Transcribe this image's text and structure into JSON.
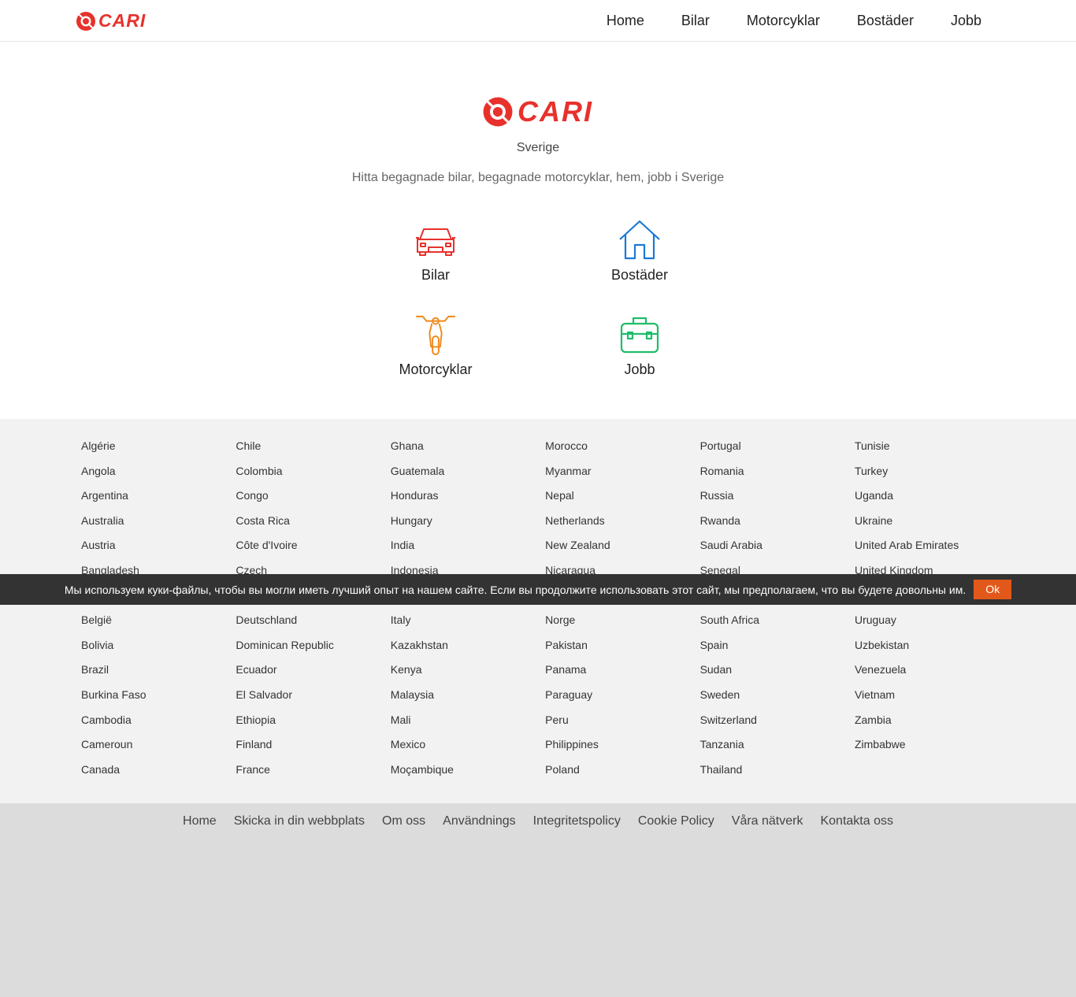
{
  "brand": {
    "name": "CARI",
    "accent": "#e8312c"
  },
  "nav": [
    "Home",
    "Bilar",
    "Motorcyklar",
    "Bostäder",
    "Jobb"
  ],
  "hero": {
    "country": "Sverige",
    "tagline": "Hitta begagnade bilar, begagnade motorcyklar, hem, jobb i Sverige",
    "categories": [
      {
        "label": "Bilar",
        "icon": "car-icon",
        "color": "#e8312c"
      },
      {
        "label": "Bostäder",
        "icon": "house-icon",
        "color": "#1a7ad4"
      },
      {
        "label": "Motorcyklar",
        "icon": "motorcycle-icon",
        "color": "#f0881a"
      },
      {
        "label": "Jobb",
        "icon": "briefcase-icon",
        "color": "#1fbd6a"
      }
    ]
  },
  "countries": [
    [
      "Algérie",
      "Angola",
      "Argentina",
      "Australia",
      "Austria",
      "Bangladesh",
      "",
      "België",
      "Bolivia",
      "Brazil",
      "Burkina Faso",
      "Cambodia",
      "Cameroun",
      "Canada"
    ],
    [
      "Chile",
      "Colombia",
      "Congo",
      "Costa Rica",
      "Côte d'Ivoire",
      "Czech",
      "",
      "Deutschland",
      "Dominican Republic",
      "Ecuador",
      "El Salvador",
      "Ethiopia",
      "Finland",
      "France"
    ],
    [
      "Ghana",
      "Guatemala",
      "Honduras",
      "Hungary",
      "India",
      "Indonesia",
      "",
      "Italy",
      "Kazakhstan",
      "Kenya",
      "Malaysia",
      "Mali",
      "Mexico",
      "Moçambique"
    ],
    [
      "Morocco",
      "Myanmar",
      "Nepal",
      "Netherlands",
      "New Zealand",
      "Nicaragua",
      "",
      "Norge",
      "Pakistan",
      "Panama",
      "Paraguay",
      "Peru",
      "Philippines",
      "Poland"
    ],
    [
      "Portugal",
      "Romania",
      "Russia",
      "Rwanda",
      "Saudi Arabia",
      "Senegal",
      "",
      "South Africa",
      "Spain",
      "Sudan",
      "Sweden",
      "Switzerland",
      "Tanzania",
      "Thailand"
    ],
    [
      "Tunisie",
      "Turkey",
      "Uganda",
      "Ukraine",
      "United Arab Emirates",
      "United Kingdom",
      "",
      "Uruguay",
      "Uzbekistan",
      "Venezuela",
      "Vietnam",
      "Zambia",
      "Zimbabwe"
    ]
  ],
  "cookie": {
    "message": "Мы используем куки-файлы, чтобы вы могли иметь лучший опыт на нашем сайте. Если вы продолжите использовать этот сайт, мы предполагаем, что вы будете довольны им.",
    "ok_label": "Ok"
  },
  "footer": [
    "Home",
    "Skicka in din webbplats",
    "Om oss",
    "Användnings",
    "Integritetspolicy",
    "Cookie Policy",
    "Våra nätverk",
    "Kontakta oss"
  ]
}
